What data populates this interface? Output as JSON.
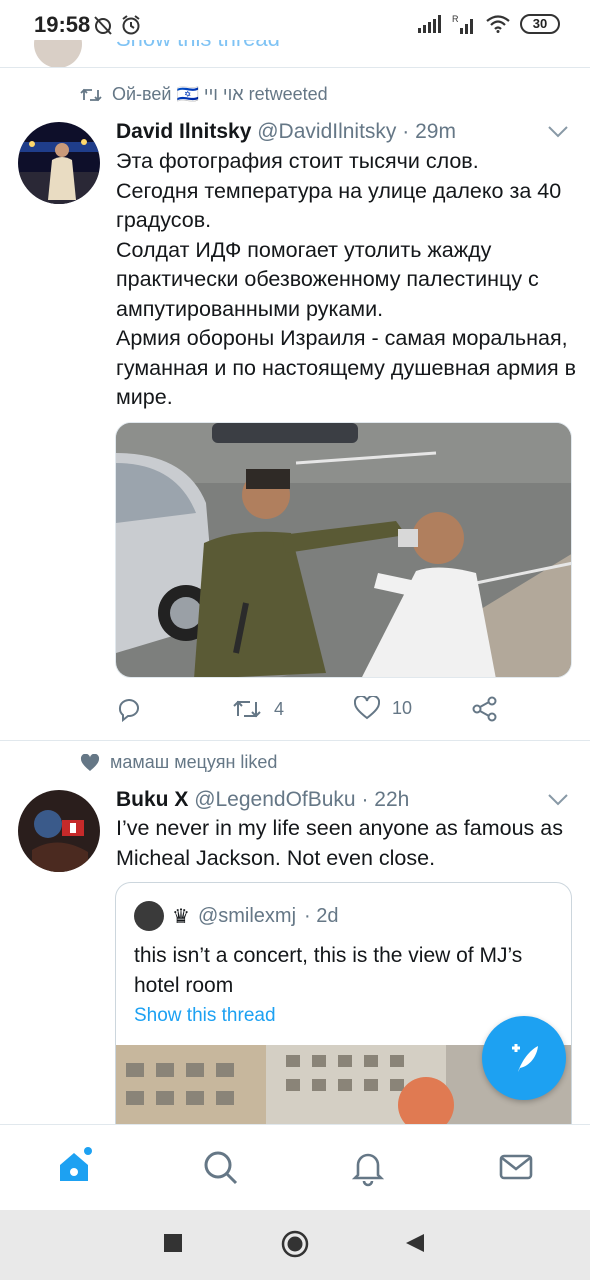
{
  "status_bar": {
    "time": "19:58",
    "battery": "30"
  },
  "previous_tweet": {
    "show_thread": "Show this thread"
  },
  "tweet1": {
    "social_context": "Ой-вей 🇮🇱 אוי ויי retweeted",
    "name": "David Ilnitsky",
    "handle": "@DavidIlnitsky",
    "time": "· 29m",
    "text": "Эта фотография стоит тысячи слов.\nСегодня температура на улице далеко за 40 градусов.\nСолдат ИДФ помогает утолить жажду практически обезвоженному палестинцу с ампутированными руками.\nАрмия обороны Израиля - самая моральная, гуманная и по настоящему душевная армия в мире.",
    "retweets": "4",
    "likes": "10"
  },
  "tweet2": {
    "social_context": "мамаш мецуян liked",
    "name": "Buku X",
    "handle": "@LegendOfBuku",
    "time": "· 22h",
    "text": "I’ve never in my life seen anyone as famous as Micheal Jackson. Not even close.",
    "quote": {
      "badge": "♛",
      "handle": "@smilexmj",
      "time": "· 2d",
      "text": "this isn’t a concert, this is the view of MJ’s hotel room",
      "show_thread": "Show this thread"
    }
  },
  "colors": {
    "accent": "#1da1f2",
    "secondary_text": "#657786",
    "border": "#e1e8ed"
  },
  "icons": {
    "status_left": [
      "alarm-off-icon",
      "alarm-icon"
    ],
    "status_right": [
      "signal-icon",
      "signal-roaming-icon",
      "wifi-icon",
      "battery-icon"
    ],
    "tweet_actions": [
      "reply-icon",
      "retweet-icon",
      "like-icon",
      "share-icon"
    ],
    "bottom_nav": [
      "home-icon",
      "search-icon",
      "notifications-icon",
      "messages-icon"
    ],
    "system_nav": [
      "recents-icon",
      "home-circle-icon",
      "back-icon"
    ]
  }
}
